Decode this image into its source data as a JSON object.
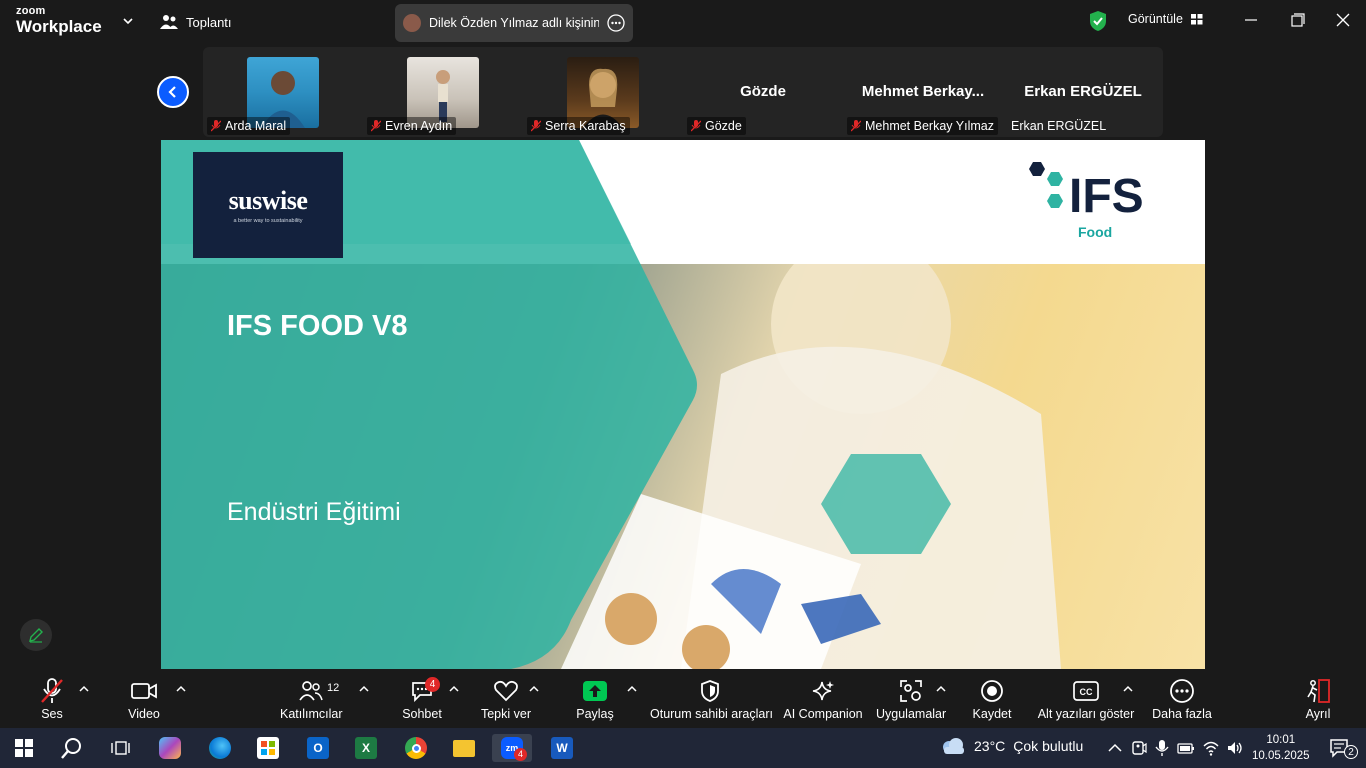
{
  "titlebar": {
    "logo_line1": "zoom",
    "logo_line2": "Workplace",
    "meeting_label": "Toplantı",
    "notification_text": "Dilek Özden Yılmaz adlı kişinin ek",
    "view_label": "Görüntüle"
  },
  "participants": [
    {
      "name": "Arda Maral",
      "has_video": true
    },
    {
      "name": "Evren Aydın",
      "has_video": true
    },
    {
      "name": "Serra Karabaş",
      "has_video": true
    },
    {
      "name": "Gözde",
      "display": "Gözde",
      "has_video": false
    },
    {
      "name": "Mehmet Berkay Yılmaz",
      "display": "Mehmet  Berkay...",
      "has_video": false
    },
    {
      "name": "Erkan ERGÜZEL",
      "display": "Erkan ERGÜZEL",
      "has_video": false
    }
  ],
  "slide": {
    "brand": "suswise",
    "brand_tagline": "a better way to sustainability",
    "title": "IFS FOOD V8",
    "subtitle": "Endüstri Eğitimi",
    "ifs_text": "IFS",
    "ifs_food": "Food"
  },
  "toolbar": {
    "audio": "Ses",
    "video": "Video",
    "participants": "Katılımcılar",
    "participants_count": "12",
    "chat": "Sohbet",
    "chat_badge": "4",
    "react": "Tepki ver",
    "share": "Paylaş",
    "host_tools": "Oturum sahibi araçları",
    "ai": "AI Companion",
    "apps": "Uygulamalar",
    "record": "Kaydet",
    "captions": "Alt yazıları göster",
    "more": "Daha fazla",
    "leave": "Ayrıl"
  },
  "taskbar": {
    "weather_temp": "23°C",
    "weather_desc": "Çok bulutlu",
    "time": "10:01",
    "date": "10.05.2025",
    "notif_count": "2",
    "zoom_badge": "4"
  },
  "colors": {
    "accent": "#0b5cff",
    "teal": "#2fb3a2",
    "share_green": "#00c853",
    "badge_red": "#e02828",
    "navy": "#13213d"
  }
}
